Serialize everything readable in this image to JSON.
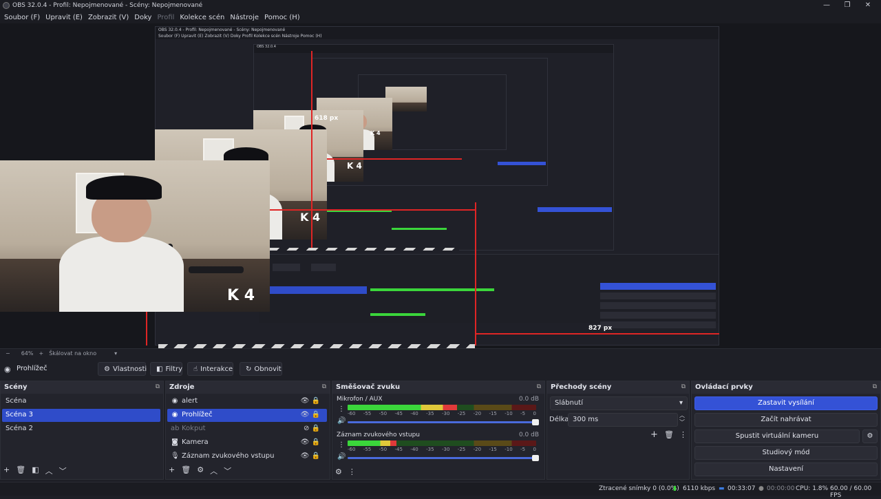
{
  "window": {
    "title": "OBS 32.0.4 - Profil: Nepojmenované - Scény: Nepojmenované",
    "minimize": "—",
    "maximize": "❐",
    "close": "✕"
  },
  "menu": [
    {
      "label": "Soubor (F)",
      "disabled": false
    },
    {
      "label": "Upravit (E)",
      "disabled": false
    },
    {
      "label": "Zobrazit (V)",
      "disabled": false
    },
    {
      "label": "Doky",
      "disabled": false
    },
    {
      "label": "Profil",
      "disabled": true
    },
    {
      "label": "Kolekce scén",
      "disabled": false
    },
    {
      "label": "Nástroje",
      "disabled": false
    },
    {
      "label": "Pomoc (H)",
      "disabled": false
    }
  ],
  "preview": {
    "overlay_text": "K 4",
    "px_label_1": "618 px",
    "px_label_2": "827 px",
    "accent_color": "#e02525"
  },
  "zoom": {
    "minus": "−",
    "level": "64%",
    "plus": "+",
    "mode_placeholder": "Škálovat na okno"
  },
  "source_toolbar": {
    "selected_source": "Prohlížeč",
    "properties": "Vlastnosti",
    "filters": "Filtry",
    "interact": "Interakce",
    "refresh": "Obnovit"
  },
  "scenes": {
    "title": "Scény",
    "items": [
      "Scéna",
      "Scéna 3",
      "Scéna 2"
    ],
    "selected_index": 1
  },
  "sources": {
    "title": "Zdroje",
    "items": [
      {
        "label": "alert",
        "icon": "globe-icon",
        "hidden": false
      },
      {
        "label": "Prohlížeč",
        "icon": "globe-icon",
        "hidden": false
      },
      {
        "label": "Kokput",
        "icon": "text-icon",
        "hidden": true
      },
      {
        "label": "Kamera",
        "icon": "camera-icon",
        "hidden": false
      },
      {
        "label": "Záznam zvukového vstupu",
        "icon": "microphone-icon",
        "hidden": false
      }
    ],
    "selected_index": 1
  },
  "mixer": {
    "title": "Směšovač zvuku",
    "channels": [
      {
        "name": "Mikrofon / AUX",
        "db": "0.0 dB",
        "level": 0.58,
        "peak": 0.7
      },
      {
        "name": "Záznam zvukového vstupu",
        "db": "0.0 dB",
        "level": 0.26,
        "peak": 0.28
      }
    ],
    "scale": [
      "-60",
      "-55",
      "-50",
      "-45",
      "-40",
      "-35",
      "-30",
      "-25",
      "-20",
      "-15",
      "-10",
      "-5",
      "0"
    ]
  },
  "transitions": {
    "title": "Přechody scény",
    "selected": "Slábnutí",
    "duration_label": "Délka",
    "duration_value": "300 ms"
  },
  "controls": {
    "title": "Ovládací prvky",
    "stop_stream": "Zastavit vysílání",
    "start_record": "Začít nahrávat",
    "virtual_cam": "Spustit virtuální kameru",
    "studio_mode": "Studiový mód",
    "settings": "Nastavení"
  },
  "status": {
    "dropped_frames": "Ztracené snímky 0 (0.0%)",
    "bitrate": "6110 kbps",
    "stream_time": "00:33:07",
    "record_time": "00:00:00",
    "cpu": "CPU: 1.8%",
    "fps": "60.00 / 60.00 FPS",
    "bitrate_color": "#3bd63b",
    "stream_color": "#3b7be0"
  }
}
